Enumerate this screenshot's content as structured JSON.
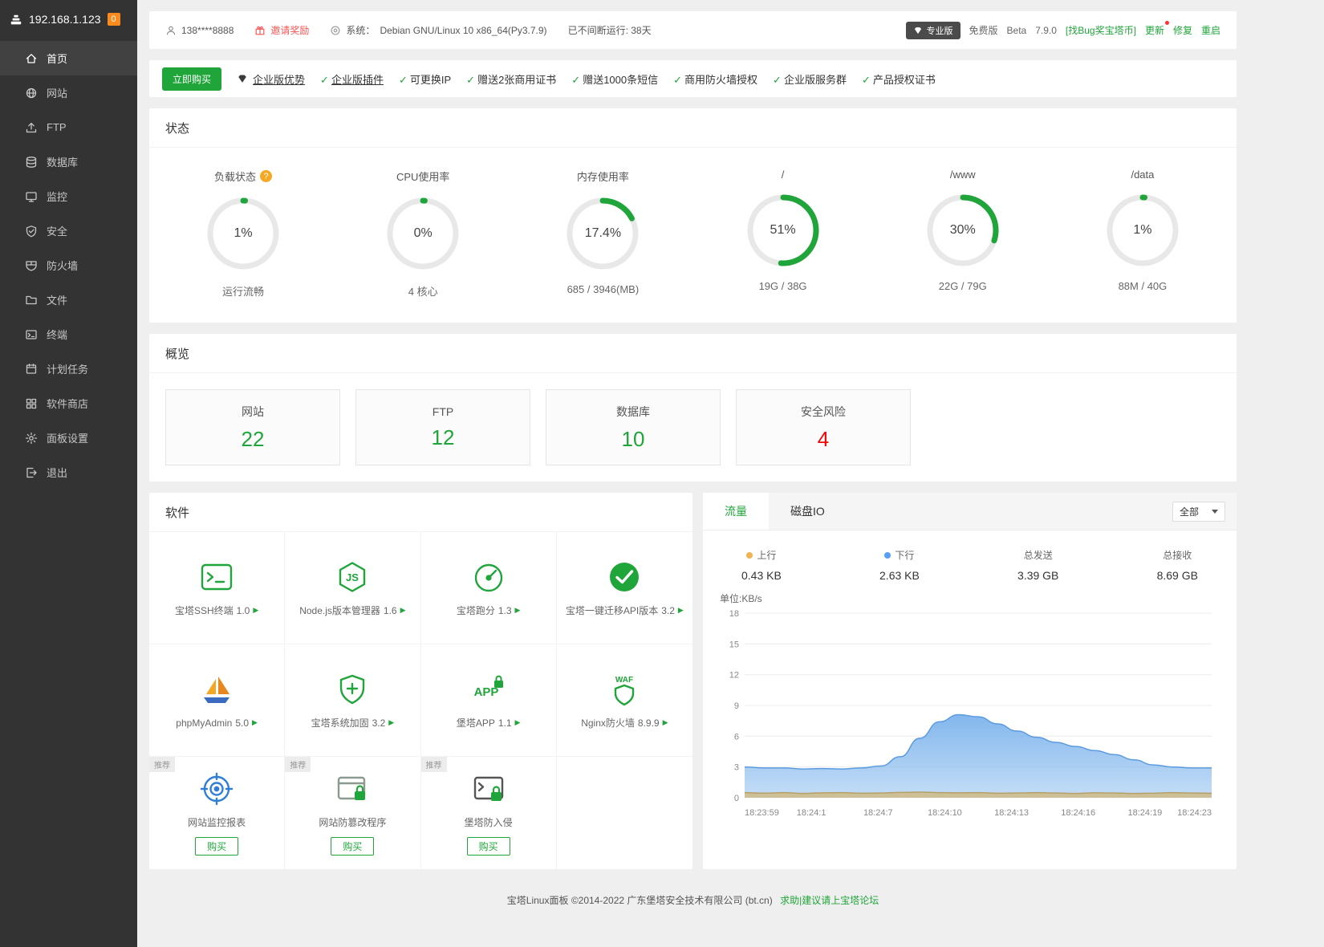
{
  "colors": {
    "green": "#20a53a",
    "red": "#ef0808",
    "badge_orange": "#fb8b1c",
    "up_dot": "#f0b357",
    "down_dot": "#559ff5"
  },
  "sidebar": {
    "logo": {
      "ip": "192.168.1.123",
      "badge": "0"
    },
    "items": [
      {
        "id": "home",
        "icon": "home",
        "label": "首页",
        "active": true
      },
      {
        "id": "sites",
        "icon": "site",
        "label": "网站"
      },
      {
        "id": "ftp",
        "icon": "ftp",
        "label": "FTP"
      },
      {
        "id": "database",
        "icon": "database",
        "label": "数据库"
      },
      {
        "id": "monitor",
        "icon": "monitor",
        "label": "监控"
      },
      {
        "id": "security",
        "icon": "security",
        "label": "安全"
      },
      {
        "id": "firewall",
        "icon": "firewall",
        "label": "防火墙"
      },
      {
        "id": "files",
        "icon": "files",
        "label": "文件"
      },
      {
        "id": "terminal",
        "icon": "terminal",
        "label": "终端"
      },
      {
        "id": "cron",
        "icon": "cron",
        "label": "计划任务"
      },
      {
        "id": "appstore",
        "icon": "store",
        "label": "软件商店"
      },
      {
        "id": "settings",
        "icon": "settings",
        "label": "面板设置"
      },
      {
        "id": "logout",
        "icon": "logout",
        "label": "退出"
      }
    ]
  },
  "topbar": {
    "phone": "138****8888",
    "invite": "邀请奖励",
    "system_label": "系统：",
    "system": "Debian GNU/Linux 10 x86_64(Py3.7.9)",
    "uptime": "已不间断运行: 38天",
    "pro_badge": "专业版",
    "edition": "免费版",
    "beta": "Beta",
    "version": "7.9.0",
    "bug_link": "[找Bug奖宝塔币]",
    "update": "更新",
    "update_dot": true,
    "repair": "修复",
    "restart": "重启"
  },
  "promo": {
    "buy_button": "立即购买",
    "headline": "企业版优势",
    "items": [
      {
        "label": "企业版插件",
        "underline": true
      },
      {
        "label": "可更换IP"
      },
      {
        "label": "赠送2张商用证书"
      },
      {
        "label": "赠送1000条短信"
      },
      {
        "label": "商用防火墙授权"
      },
      {
        "label": "企业版服务群"
      },
      {
        "label": "产品授权证书"
      }
    ]
  },
  "status": {
    "title": "状态",
    "gauges": [
      {
        "id": "load",
        "label": "负载状态",
        "help": true,
        "percent": 1,
        "value": "1%",
        "sub": "运行流畅"
      },
      {
        "id": "cpu",
        "label": "CPU使用率",
        "percent": 0,
        "value": "0%",
        "sub": "4 核心"
      },
      {
        "id": "mem",
        "label": "内存使用率",
        "percent": 17.4,
        "value": "17.4%",
        "sub": "685 / 3946(MB)"
      },
      {
        "id": "root",
        "label": "/",
        "percent": 51,
        "value": "51%",
        "sub": "19G / 38G"
      },
      {
        "id": "www",
        "label": "/www",
        "percent": 30,
        "value": "30%",
        "sub": "22G / 79G"
      },
      {
        "id": "data",
        "label": "/data",
        "percent": 1,
        "value": "1%",
        "sub": "88M / 40G"
      }
    ]
  },
  "overview": {
    "title": "概览",
    "boxes": [
      {
        "id": "sites",
        "label": "网站",
        "value": "22",
        "color": "green"
      },
      {
        "id": "ftp",
        "label": "FTP",
        "value": "12",
        "color": "green"
      },
      {
        "id": "database",
        "label": "数据库",
        "value": "10",
        "color": "green"
      },
      {
        "id": "risk",
        "label": "安全风险",
        "value": "4",
        "color": "red"
      }
    ]
  },
  "software": {
    "title": "软件",
    "recommend_tag": "推荐",
    "buy_label": "购买",
    "items": [
      {
        "name": "宝塔SSH终端",
        "version": "1.0",
        "icon": "ssh-terminal"
      },
      {
        "name": "Node.js版本管理器",
        "version": "1.6",
        "icon": "nodejs"
      },
      {
        "name": "宝塔跑分",
        "version": "1.3",
        "icon": "benchmark"
      },
      {
        "name": "宝塔一键迁移API版本",
        "version": "3.2",
        "icon": "migrate-check"
      },
      {
        "name": "phpMyAdmin",
        "version": "5.0",
        "icon": "phpmyadmin"
      },
      {
        "name": "宝塔系统加固",
        "version": "3.2",
        "icon": "shield-plus"
      },
      {
        "name": "堡塔APP",
        "version": "1.1",
        "icon": "mobile-app"
      },
      {
        "name": "Nginx防火墙",
        "version": "8.9.9",
        "icon": "waf-shield"
      },
      {
        "name": "网站监控报表",
        "icon": "monitor-report",
        "recommend": true,
        "buy": true
      },
      {
        "name": "网站防篡改程序",
        "icon": "tamper-proof",
        "recommend": true,
        "buy": true
      },
      {
        "name": "堡塔防入侵",
        "icon": "intrusion-lock",
        "recommend": true,
        "buy": true
      }
    ]
  },
  "traffic": {
    "tabs": [
      {
        "id": "traffic",
        "label": "流量",
        "active": true
      },
      {
        "id": "disk-io",
        "label": "磁盘IO"
      }
    ],
    "filter": "全部",
    "stats": [
      {
        "id": "up",
        "label": "上行",
        "value": "0.43 KB",
        "dot": "#f0b357"
      },
      {
        "id": "down",
        "label": "下行",
        "value": "2.63 KB",
        "dot": "#559ff5"
      },
      {
        "id": "total-sent",
        "label": "总发送",
        "value": "3.39 GB"
      },
      {
        "id": "total-received",
        "label": "总接收",
        "value": "8.69 GB"
      }
    ],
    "unit": "单位:KB/s"
  },
  "chart_data": {
    "type": "area",
    "title": "流量",
    "ylabel": "单位:KB/s",
    "ylim": [
      0,
      18
    ],
    "yticks": [
      0,
      3,
      6,
      9,
      12,
      15,
      18
    ],
    "grid": true,
    "legend_position": "top",
    "x_labels": [
      "18:23:59",
      "18:24:1",
      "18:24:7",
      "18:24:10",
      "18:24:13",
      "18:24:16",
      "18:24:19",
      "18:24:23"
    ],
    "series": [
      {
        "name": "上行",
        "color": "#cebd8c",
        "values": [
          0.5,
          0.45,
          0.5,
          0.42,
          0.48,
          0.5,
          0.44,
          0.46,
          0.52,
          0.55,
          0.5,
          0.48,
          0.5,
          0.44,
          0.46,
          0.5,
          0.46,
          0.42,
          0.48,
          0.46,
          0.42,
          0.44,
          0.5,
          0.46,
          0.44
        ]
      },
      {
        "name": "下行",
        "color": "#7cb3ec",
        "values": [
          3.0,
          2.9,
          2.9,
          2.8,
          2.85,
          2.8,
          2.9,
          3.1,
          4.0,
          5.8,
          7.4,
          8.1,
          7.9,
          7.2,
          6.5,
          5.9,
          5.4,
          5.0,
          4.6,
          4.2,
          3.7,
          3.2,
          3.0,
          2.9,
          2.9
        ]
      }
    ]
  },
  "footer": {
    "copyright": "宝塔Linux面板 ©2014-2022 广东堡塔安全技术有限公司 (bt.cn)",
    "help_link": "求助|建议请上宝塔论坛"
  }
}
